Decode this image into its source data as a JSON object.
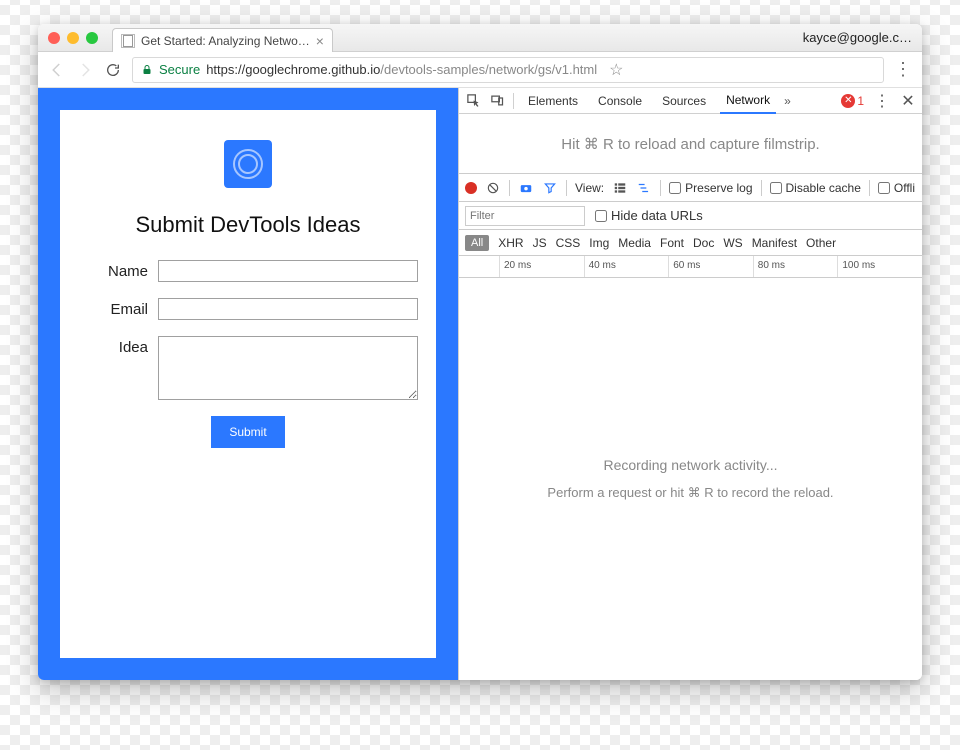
{
  "browser": {
    "user": "kayce@google.c…",
    "tab_title": "Get Started: Analyzing Netwo…",
    "secure_label": "Secure",
    "url_origin": "https://googlechrome.github.io",
    "url_path": "/devtools-samples/network/gs/v1.html"
  },
  "page": {
    "title": "Submit DevTools Ideas",
    "labels": {
      "name": "Name",
      "email": "Email",
      "idea": "Idea"
    },
    "submit": "Submit"
  },
  "devtools": {
    "tabs": [
      "Elements",
      "Console",
      "Sources",
      "Network"
    ],
    "active_tab": "Network",
    "error_count": "1",
    "filmstrip_hint": "Hit ⌘ R to reload and capture filmstrip.",
    "toolbar": {
      "view_label": "View:",
      "preserve_log": "Preserve log",
      "disable_cache": "Disable cache",
      "offline": "Offli"
    },
    "filter_placeholder": "Filter",
    "hide_data_urls": "Hide data URLs",
    "types": [
      "All",
      "XHR",
      "JS",
      "CSS",
      "Img",
      "Media",
      "Font",
      "Doc",
      "WS",
      "Manifest",
      "Other"
    ],
    "timeline": [
      "20 ms",
      "40 ms",
      "60 ms",
      "80 ms",
      "100 ms"
    ],
    "recording_msg": "Recording network activity...",
    "recording_hint": "Perform a request or hit ⌘ R to record the reload."
  }
}
